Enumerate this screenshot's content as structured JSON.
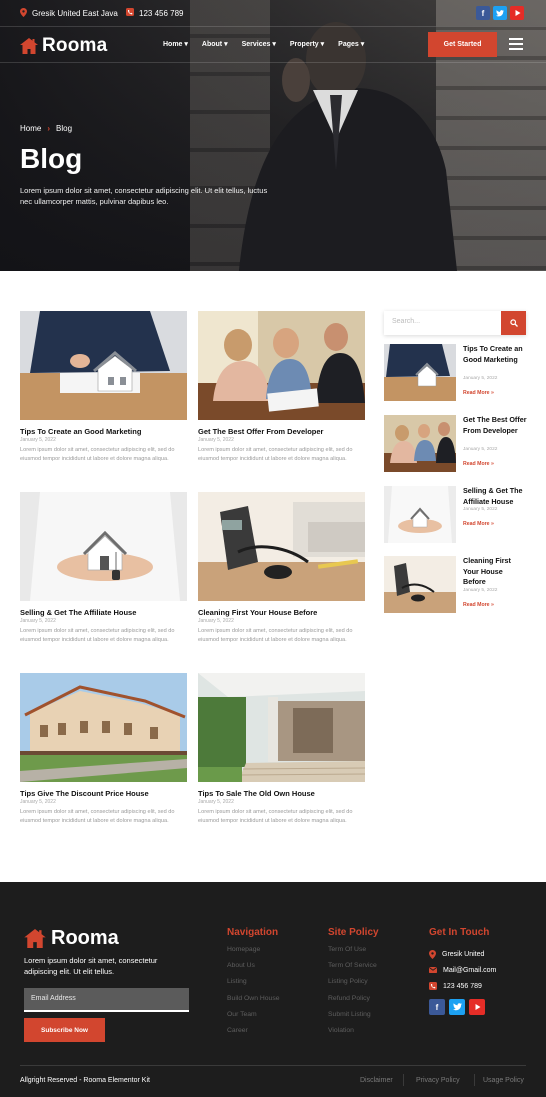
{
  "topbar": {
    "location": "Gresik United East Java",
    "phone": "123 456 789"
  },
  "brand": {
    "name": "Rooma",
    "accent": "#d2462f"
  },
  "nav": {
    "items": [
      "Home",
      "About",
      "Services",
      "Property",
      "Pages"
    ],
    "cta": "Get Started"
  },
  "hero": {
    "breadcrumb_home": "Home",
    "breadcrumb_current": "Blog",
    "title": "Blog",
    "description": "Lorem ipsum dolor sit amet, consectetur adipiscing elit. Ut elit tellus, luctus nec ullamcorper mattis, pulvinar dapibus leo."
  },
  "posts": [
    {
      "title": "Tips To Create an Good Marketing",
      "date": "January 5, 2022",
      "excerpt": "Lorem ipsum dolor sit amet, consectetur adipiscing elit, sed do eiusmod tempor incididunt ut labore et dolore magna aliqua."
    },
    {
      "title": "Get The Best Offer From Developer",
      "date": "January 5, 2022",
      "excerpt": "Lorem ipsum dolor sit amet, consectetur adipiscing elit, sed do eiusmod tempor incididunt ut labore et dolore magna aliqua."
    },
    {
      "title": "Selling & Get The Affiliate House",
      "date": "January 5, 2022",
      "excerpt": "Lorem ipsum dolor sit amet, consectetur adipiscing elit, sed do eiusmod tempor incididunt ut labore et dolore magna aliqua."
    },
    {
      "title": "Cleaning First Your House Before",
      "date": "January 5, 2022",
      "excerpt": "Lorem ipsum dolor sit amet, consectetur adipiscing elit, sed do eiusmod tempor incididunt ut labore et dolore magna aliqua."
    },
    {
      "title": "Tips Give The Discount Price House",
      "date": "January 5, 2022",
      "excerpt": "Lorem ipsum dolor sit amet, consectetur adipiscing elit, sed do eiusmod tempor incididunt ut labore et dolore magna aliqua."
    },
    {
      "title": "Tips To Sale The Old Own House",
      "date": "January 5, 2022",
      "excerpt": "Lorem ipsum dolor sit amet, consectetur adipiscing elit, sed do eiusmod tempor incididunt ut labore et dolore magna aliqua."
    }
  ],
  "sidebar": {
    "search_placeholder": "Search...",
    "read_more": "Read More »",
    "posts": [
      {
        "title": "Tips To Create an Good Marketing",
        "date": "January 5, 2022"
      },
      {
        "title": "Get The Best Offer From Developer",
        "date": "January 5, 2022"
      },
      {
        "title": "Selling & Get The Affiliate House",
        "date": "January 5, 2022"
      },
      {
        "title": "Cleaning First Your House Before",
        "date": "January 5, 2022"
      }
    ]
  },
  "footer": {
    "brand": "Rooma",
    "description": "Lorem ipsum dolor sit amet, consectetur adipiscing elit. Ut elit tellus.",
    "email_placeholder": "Email Address",
    "subscribe": "Subscribe Now",
    "navigation_title": "Navigation",
    "navigation": [
      "Homepage",
      "About Us",
      "Listing",
      "Build Own House",
      "Our Team",
      "Career"
    ],
    "policy_title": "Site Policy",
    "policy": [
      "Term Of Use",
      "Term Of Service",
      "Listing Policy",
      "Refund Policy",
      "Submit Listing",
      "Violation"
    ],
    "contact_title": "Get In Touch",
    "contact_location": "Gresik United",
    "contact_email": "Mail@Gmail.com",
    "contact_phone": "123 456 789",
    "copyright": "Allgright Reserved - Rooma Elementor Kit",
    "bottom_links": [
      "Disclaimer",
      "Privacy Policy",
      "Usage Policy"
    ]
  }
}
